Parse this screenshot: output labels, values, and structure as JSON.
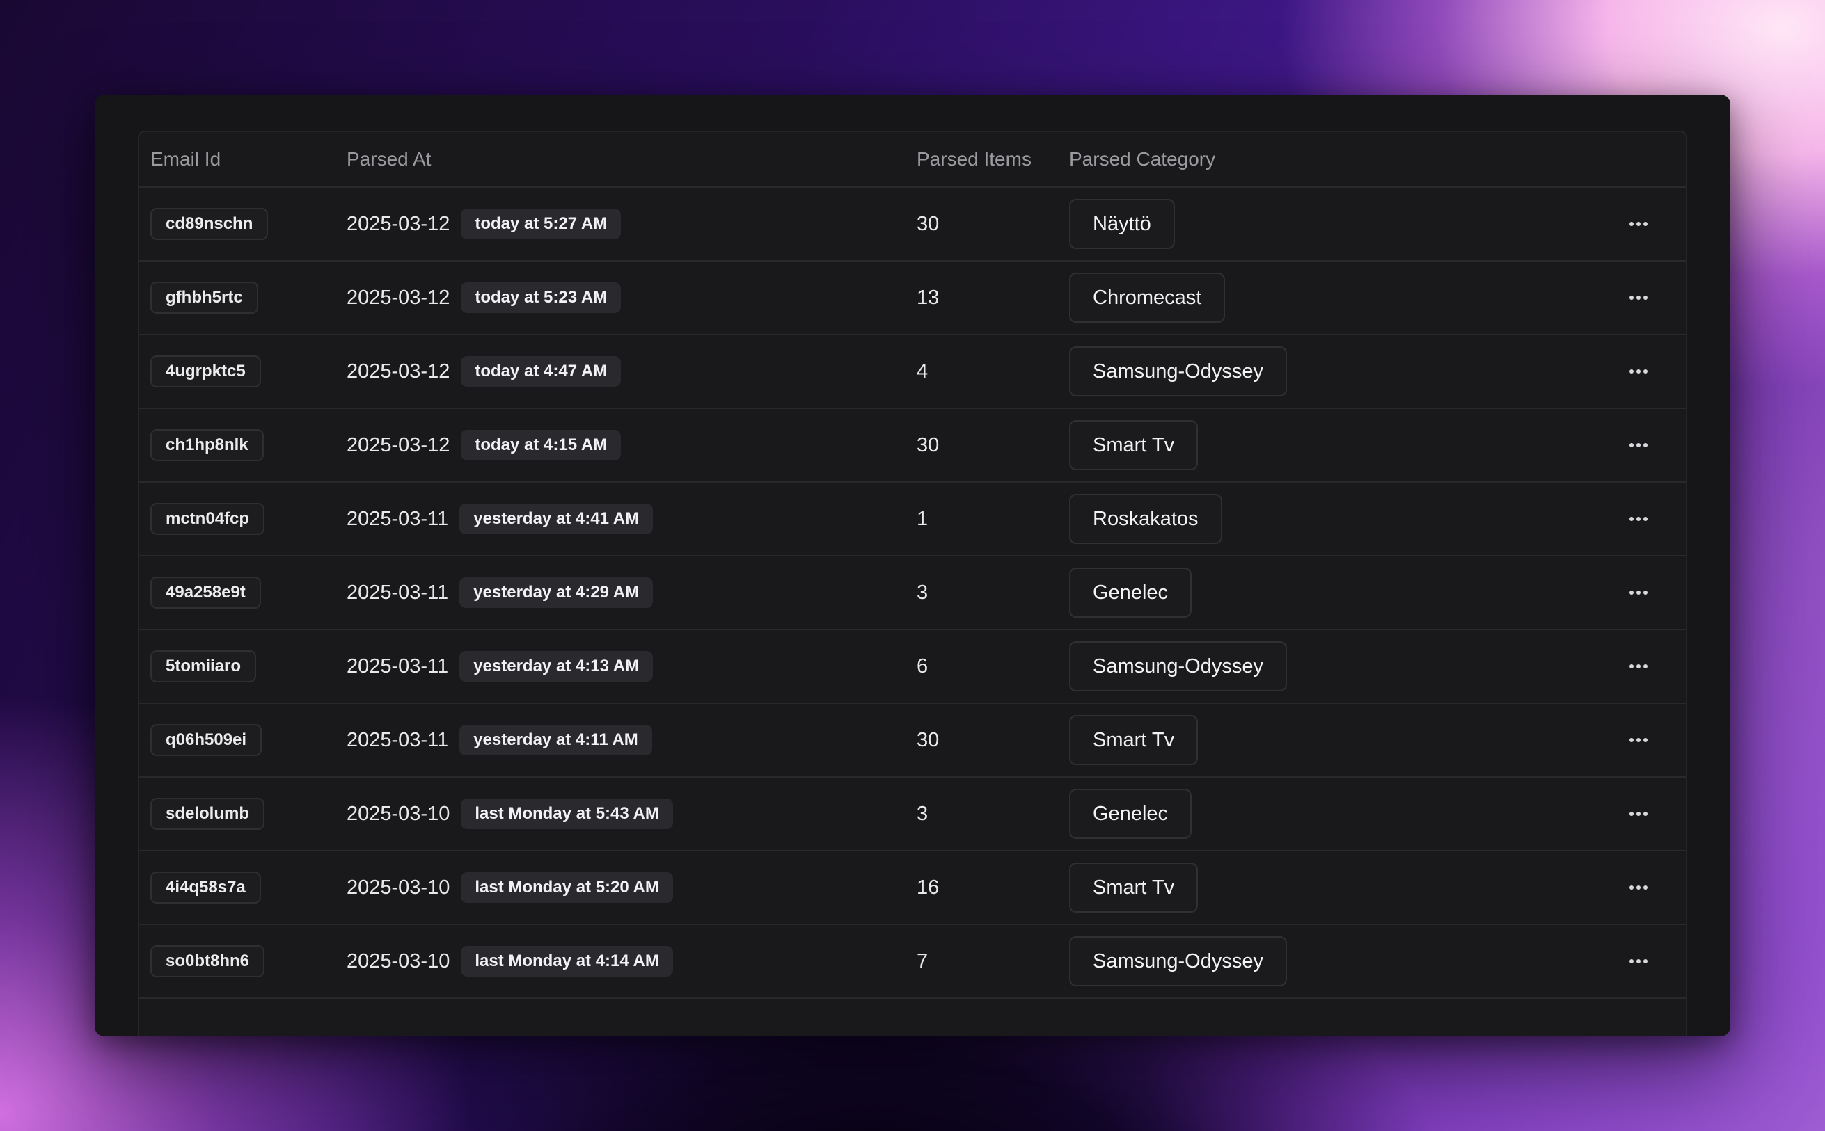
{
  "table": {
    "columns": {
      "email_id": "Email Id",
      "parsed_at": "Parsed At",
      "parsed_items": "Parsed Items",
      "parsed_category": "Parsed Category"
    },
    "rows": [
      {
        "email_id": "cd89nschn",
        "date": "2025-03-12",
        "relative": "today at 5:27 AM",
        "items": "30",
        "category": "Näyttö"
      },
      {
        "email_id": "gfhbh5rtc",
        "date": "2025-03-12",
        "relative": "today at 5:23 AM",
        "items": "13",
        "category": "Chromecast"
      },
      {
        "email_id": "4ugrpktc5",
        "date": "2025-03-12",
        "relative": "today at 4:47 AM",
        "items": "4",
        "category": "Samsung-Odyssey"
      },
      {
        "email_id": "ch1hp8nlk",
        "date": "2025-03-12",
        "relative": "today at 4:15 AM",
        "items": "30",
        "category": "Smart Tv"
      },
      {
        "email_id": "mctn04fcp",
        "date": "2025-03-11",
        "relative": "yesterday at 4:41 AM",
        "items": "1",
        "category": "Roskakatos"
      },
      {
        "email_id": "49a258e9t",
        "date": "2025-03-11",
        "relative": "yesterday at 4:29 AM",
        "items": "3",
        "category": "Genelec"
      },
      {
        "email_id": "5tomiiaro",
        "date": "2025-03-11",
        "relative": "yesterday at 4:13 AM",
        "items": "6",
        "category": "Samsung-Odyssey"
      },
      {
        "email_id": "q06h509ei",
        "date": "2025-03-11",
        "relative": "yesterday at 4:11 AM",
        "items": "30",
        "category": "Smart Tv"
      },
      {
        "email_id": "sdelolumb",
        "date": "2025-03-10",
        "relative": "last Monday at 5:43 AM",
        "items": "3",
        "category": "Genelec"
      },
      {
        "email_id": "4i4q58s7a",
        "date": "2025-03-10",
        "relative": "last Monday at 5:20 AM",
        "items": "16",
        "category": "Smart Tv"
      },
      {
        "email_id": "so0bt8hn6",
        "date": "2025-03-10",
        "relative": "last Monday at 4:14 AM",
        "items": "7",
        "category": "Samsung-Odyssey"
      }
    ],
    "row_action_icon": "more-horizontal-icon"
  }
}
